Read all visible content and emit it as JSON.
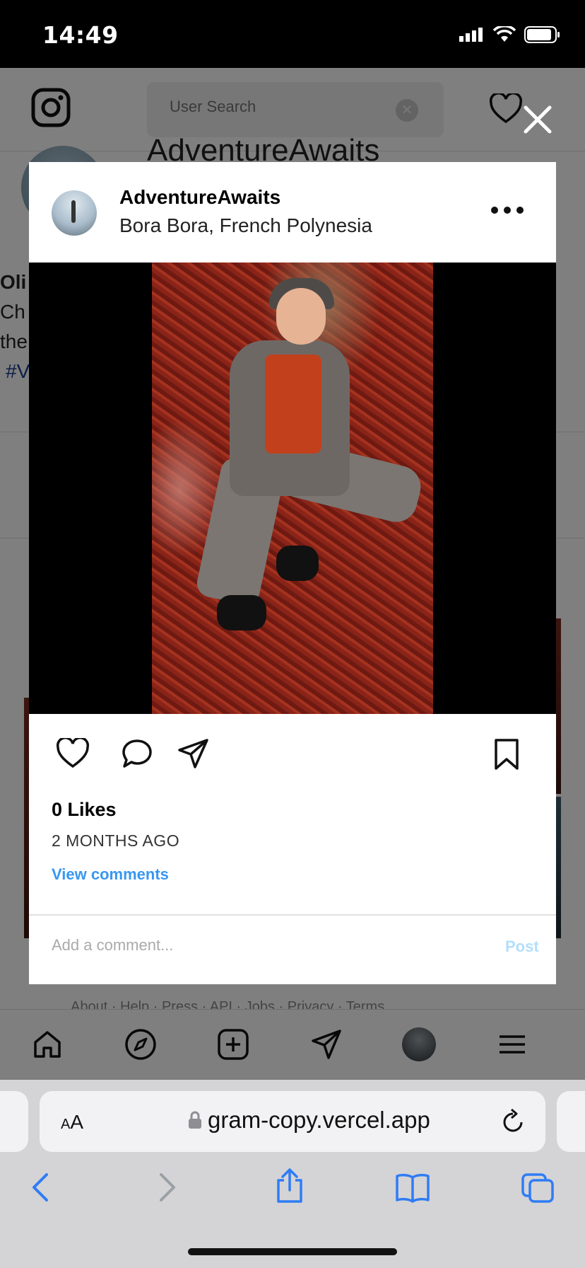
{
  "status_bar": {
    "time": "14:49"
  },
  "header": {
    "search_placeholder": "User Search"
  },
  "background": {
    "profile_title": "AdventureAwaits",
    "caption_user": "Oli",
    "caption_line1": "Ch",
    "caption_line2": "the",
    "caption_tag": "#V",
    "footer_links": "About · Help · Press · API · Jobs · Privacy · Terms"
  },
  "post": {
    "username": "AdventureAwaits",
    "location": "Bora Bora, French Polynesia",
    "likes": "0 Likes",
    "time_ago": "2 MONTHS AGO",
    "view_comments": "View comments",
    "comment_placeholder": "Add a comment...",
    "post_label": "Post"
  },
  "browser": {
    "url": "gram-copy.vercel.app",
    "text_size_label": "AA"
  },
  "colors": {
    "link_blue": "#3897f0",
    "post_disabled": "#b2dffc",
    "safari_blue": "#2f7cf6"
  }
}
